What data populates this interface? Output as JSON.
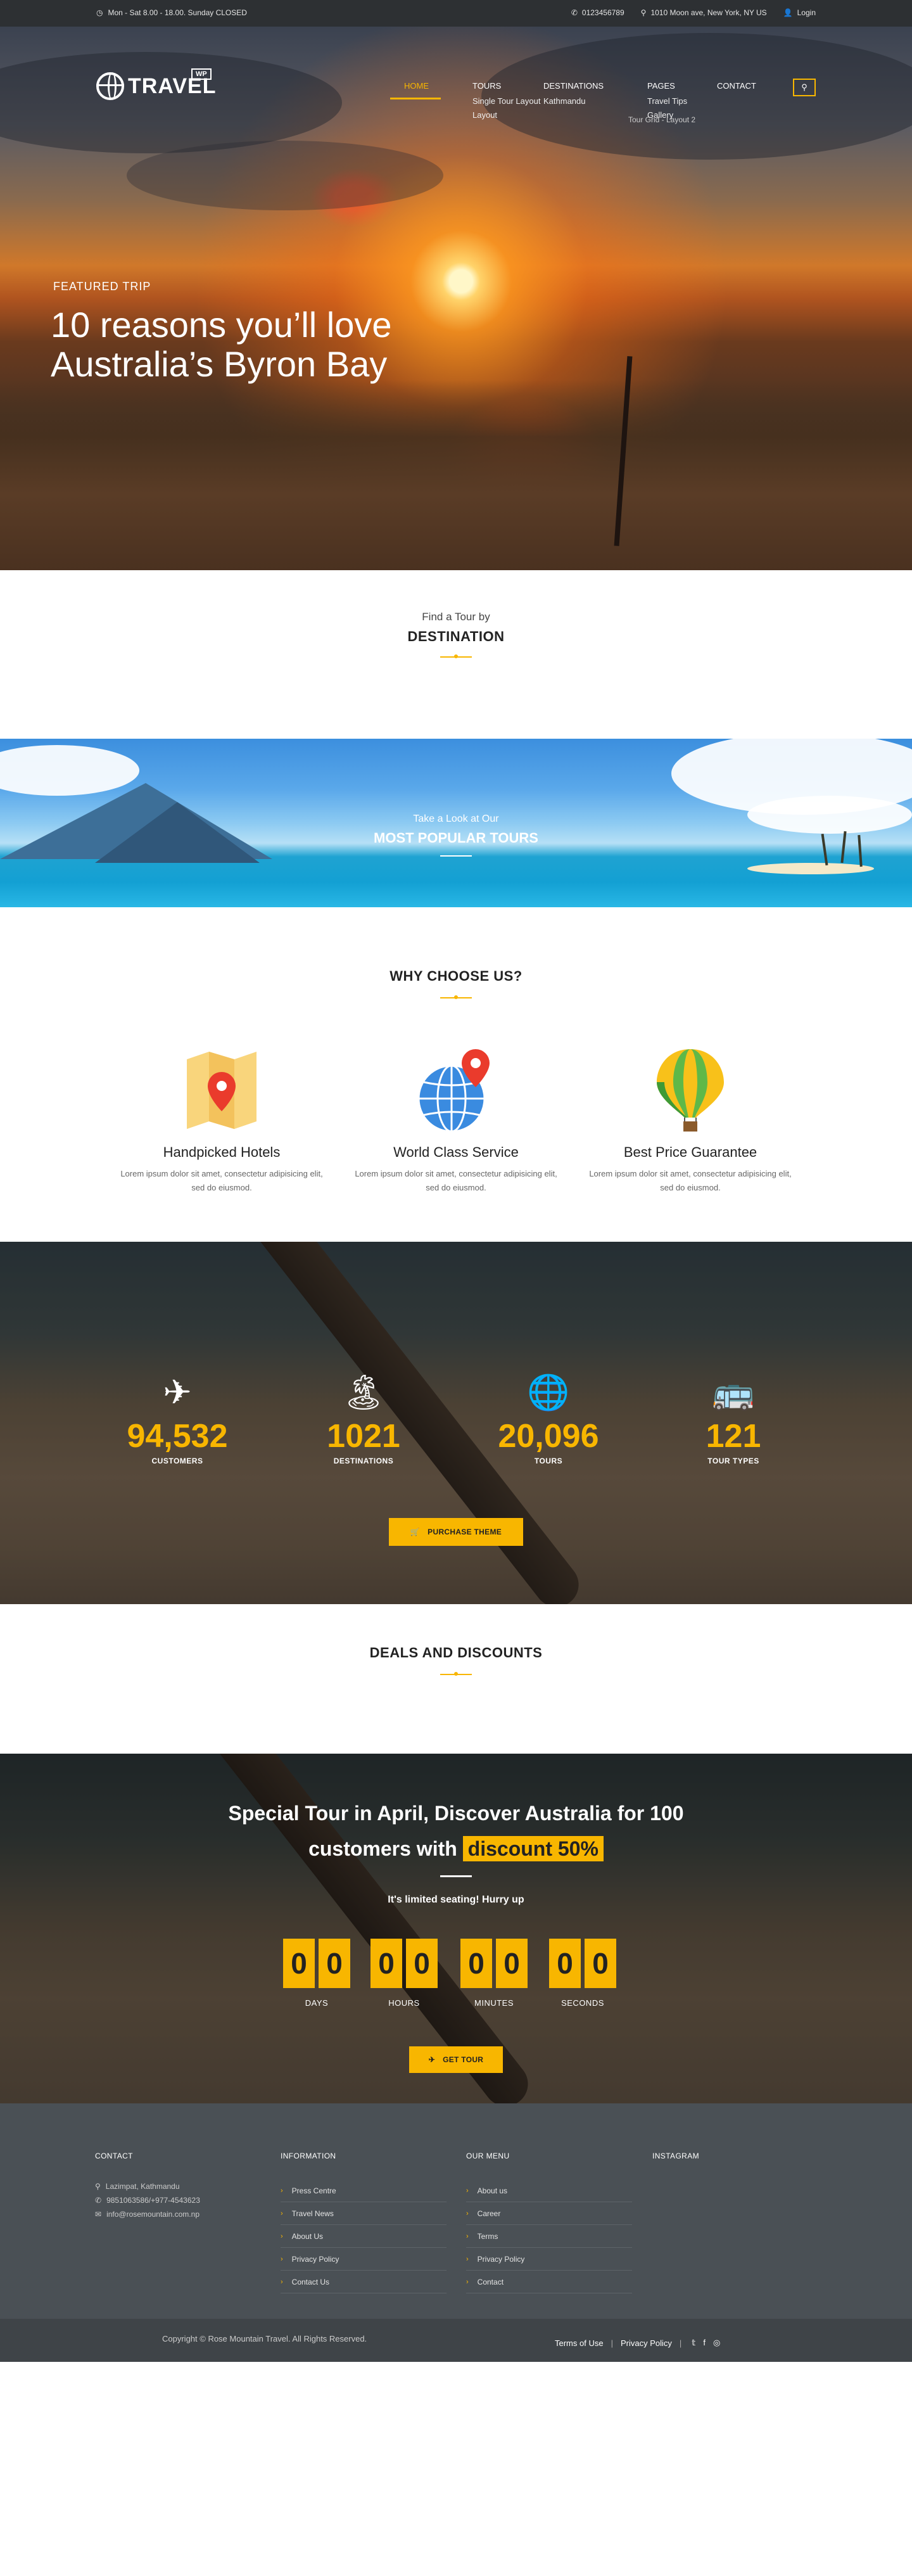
{
  "topbar": {
    "hours": "Mon - Sat 8.00 - 18.00. Sunday CLOSED",
    "phone": "0123456789",
    "address": "1010 Moon ave, New York, NY US",
    "login": "Login"
  },
  "brand": {
    "name": "TRAVEL",
    "badge": "WP"
  },
  "nav": {
    "home": "HOME",
    "tours": "TOURS",
    "destinations": "DESTINATIONS",
    "pages": "PAGES",
    "contact": "CONTACT",
    "sub_tour_layout": "Single Tour Layout",
    "sub_layout": "Layout",
    "sub_kathmandu": "Kathmandu",
    "sub_travel_tips": "Travel Tips",
    "sub_gallery": "Gallery",
    "sub_tour_grid": "Tour Grid - Layout 2"
  },
  "hero": {
    "kicker": "FEATURED TRIP",
    "title_line1": "10 reasons you’ll love",
    "title_line2": "Australia’s Byron Bay"
  },
  "destination": {
    "small": "Find a Tour by",
    "big": "DESTINATION"
  },
  "popular": {
    "small": "Take a Look at Our",
    "big": "MOST POPULAR TOURS"
  },
  "why": {
    "heading": "WHY CHOOSE US?",
    "items": [
      {
        "title": "Handpicked Hotels",
        "text": "Lorem ipsum dolor sit amet, consectetur adipisicing elit, sed do eiusmod."
      },
      {
        "title": "World Class Service",
        "text": "Lorem ipsum dolor sit amet, consectetur adipisicing elit, sed do eiusmod."
      },
      {
        "title": "Best Price Guarantee",
        "text": "Lorem ipsum dolor sit amet, consectetur adipisicing elit, sed do eiusmod."
      }
    ]
  },
  "stats": {
    "items": [
      {
        "value": "94,532",
        "label": "CUSTOMERS",
        "icon": "airplane-icon"
      },
      {
        "value": "1021",
        "label": "DESTINATIONS",
        "icon": "palm-island-icon"
      },
      {
        "value": "20,096",
        "label": "TOURS",
        "icon": "globe-icon"
      },
      {
        "value": "121",
        "label": "TOUR TYPES",
        "icon": "bus-icon"
      }
    ],
    "button": "PURCHASE THEME"
  },
  "deals": {
    "heading": "DEALS AND DISCOUNTS"
  },
  "special": {
    "line1": "Special Tour in April, Discover Australia for 100",
    "line2_pre": "customers with",
    "line2_highlight": "discount 50%",
    "sub": "It's limited seating! Hurry up",
    "countdown": [
      {
        "d1": "0",
        "d2": "0",
        "label": "DAYS"
      },
      {
        "d1": "0",
        "d2": "0",
        "label": "HOURS"
      },
      {
        "d1": "0",
        "d2": "0",
        "label": "MINUTES"
      },
      {
        "d1": "0",
        "d2": "0",
        "label": "SECONDS"
      }
    ],
    "button": "GET TOUR"
  },
  "footer": {
    "contact": {
      "heading": "CONTACT",
      "address": "Lazimpat, Kathmandu",
      "phone": "9851063586/+977-4543623",
      "email": "info@rosemountain.com.np"
    },
    "information": {
      "heading": "INFORMATION",
      "links": [
        "Press Centre",
        "Travel News",
        "About Us",
        "Privacy Policy",
        "Contact Us"
      ]
    },
    "menu": {
      "heading": "OUR MENU",
      "links": [
        "About us",
        "Career",
        "Terms",
        "Privacy Policy",
        "Contact"
      ]
    },
    "instagram": {
      "heading": "INSTAGRAM"
    },
    "copyright": "Copyright © Rose Mountain Travel. All Rights Reserved.",
    "terms": "Terms of Use",
    "privacy": "Privacy Policy"
  },
  "colors": {
    "accent": "#f8b600",
    "topbar": "#2d3033",
    "footer": "#4a5055"
  }
}
